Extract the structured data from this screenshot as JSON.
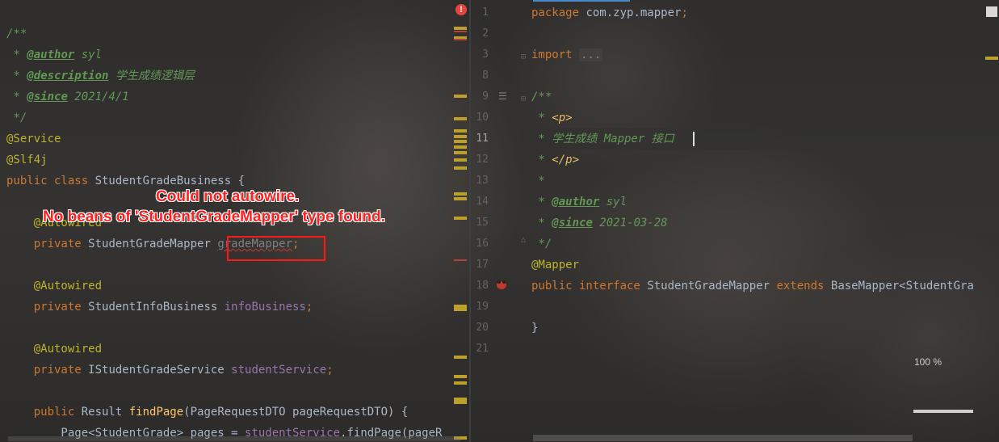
{
  "left_code": {
    "lines": [
      [
        {
          "c": "cm",
          "t": "/**"
        }
      ],
      [
        {
          "c": "cm",
          "t": " * "
        },
        {
          "c": "tag",
          "t": "@author"
        },
        {
          "c": "cm",
          "t": " syl"
        }
      ],
      [
        {
          "c": "cm",
          "t": " * "
        },
        {
          "c": "tag",
          "t": "@description"
        },
        {
          "c": "cm",
          "t": " 学生成绩逻辑层"
        }
      ],
      [
        {
          "c": "cm",
          "t": " * "
        },
        {
          "c": "tag",
          "t": "@since"
        },
        {
          "c": "cm",
          "t": " 2021/4/1"
        }
      ],
      [
        {
          "c": "cm",
          "t": " */"
        }
      ],
      [
        {
          "c": "ann",
          "t": "@Service"
        }
      ],
      [
        {
          "c": "ann",
          "t": "@Slf4j"
        }
      ],
      [
        {
          "c": "kw",
          "t": "public class "
        },
        {
          "c": "plain",
          "t": "StudentGradeBusiness {"
        }
      ],
      [],
      [
        {
          "c": "ann",
          "t": "    @Autowired"
        }
      ],
      [
        {
          "c": "kw",
          "t": "    private "
        },
        {
          "c": "plain",
          "t": "StudentGradeMapper "
        },
        {
          "c": "gray squiggle",
          "t": "gradeMapper"
        },
        {
          "c": "kw",
          "t": ";"
        }
      ],
      [],
      [
        {
          "c": "ann",
          "t": "    @Autowired"
        }
      ],
      [
        {
          "c": "kw",
          "t": "    private "
        },
        {
          "c": "plain",
          "t": "StudentInfoBusiness "
        },
        {
          "c": "fld",
          "t": "infoBusiness"
        },
        {
          "c": "kw",
          "t": ";"
        }
      ],
      [],
      [
        {
          "c": "ann",
          "t": "    @Autowired"
        }
      ],
      [
        {
          "c": "kw",
          "t": "    private "
        },
        {
          "c": "plain",
          "t": "IStudentGradeService "
        },
        {
          "c": "fld",
          "t": "studentService"
        },
        {
          "c": "kw",
          "t": ";"
        }
      ],
      [],
      [
        {
          "c": "kw",
          "t": "    public "
        },
        {
          "c": "plain",
          "t": "Result "
        },
        {
          "c": "fn",
          "t": "findPage"
        },
        {
          "c": "plain",
          "t": "(PageRequestDTO pageRequestDTO) {"
        }
      ],
      [
        {
          "c": "plain",
          "t": "        Page<StudentGrade> pages = "
        },
        {
          "c": "fld",
          "t": "studentService"
        },
        {
          "c": "plain",
          "t": ".findPage(pageR"
        }
      ]
    ]
  },
  "right_code": {
    "line_numbers": [
      "1",
      "2",
      "3",
      "8",
      "9",
      "10",
      "11",
      "12",
      "13",
      "14",
      "15",
      "16",
      "17",
      "18",
      "19",
      "20",
      "21"
    ],
    "lines": [
      [
        {
          "c": "kw",
          "t": "package "
        },
        {
          "c": "pkg",
          "t": "com.zyp.mapper"
        },
        {
          "c": "kw",
          "t": ";"
        }
      ],
      [],
      [
        {
          "c": "kw",
          "t": "import "
        },
        {
          "c": "fold",
          "t": "..."
        }
      ],
      [],
      [
        {
          "c": "cm",
          "t": "/**"
        }
      ],
      [
        {
          "c": "cm",
          "t": " * "
        },
        {
          "c": "html-tag",
          "t": "<p>"
        }
      ],
      [
        {
          "c": "cm",
          "t": " * 学生成绩 Mapper 接口"
        }
      ],
      [
        {
          "c": "cm",
          "t": " * "
        },
        {
          "c": "html-tag",
          "t": "</p>"
        }
      ],
      [
        {
          "c": "cm",
          "t": " *"
        }
      ],
      [
        {
          "c": "cm",
          "t": " * "
        },
        {
          "c": "tag",
          "t": "@author"
        },
        {
          "c": "cm",
          "t": " syl"
        }
      ],
      [
        {
          "c": "cm",
          "t": " * "
        },
        {
          "c": "tag",
          "t": "@since"
        },
        {
          "c": "cm",
          "t": " 2021-03-28"
        }
      ],
      [
        {
          "c": "cm",
          "t": " */"
        }
      ],
      [
        {
          "c": "ann",
          "t": "@Mapper"
        }
      ],
      [
        {
          "c": "kw",
          "t": "public interface "
        },
        {
          "c": "plain",
          "t": "StudentGradeMapper "
        },
        {
          "c": "kw",
          "t": "extends "
        },
        {
          "c": "plain",
          "t": "BaseMapper<StudentGra"
        }
      ],
      [],
      [
        {
          "c": "plain",
          "t": "}"
        }
      ],
      []
    ]
  },
  "error_annotation": {
    "line1": "Could not autowire.",
    "line2": "No beans of 'StudentGradeMapper' type found."
  },
  "error_icon_glyph": "!",
  "zoom_level": "100 %",
  "colors": {
    "background": "#2b2b2b",
    "comment": "#629755",
    "annotation": "#bbb529",
    "keyword": "#cc7832",
    "field": "#9876aa",
    "error_red": "#ff2020"
  }
}
